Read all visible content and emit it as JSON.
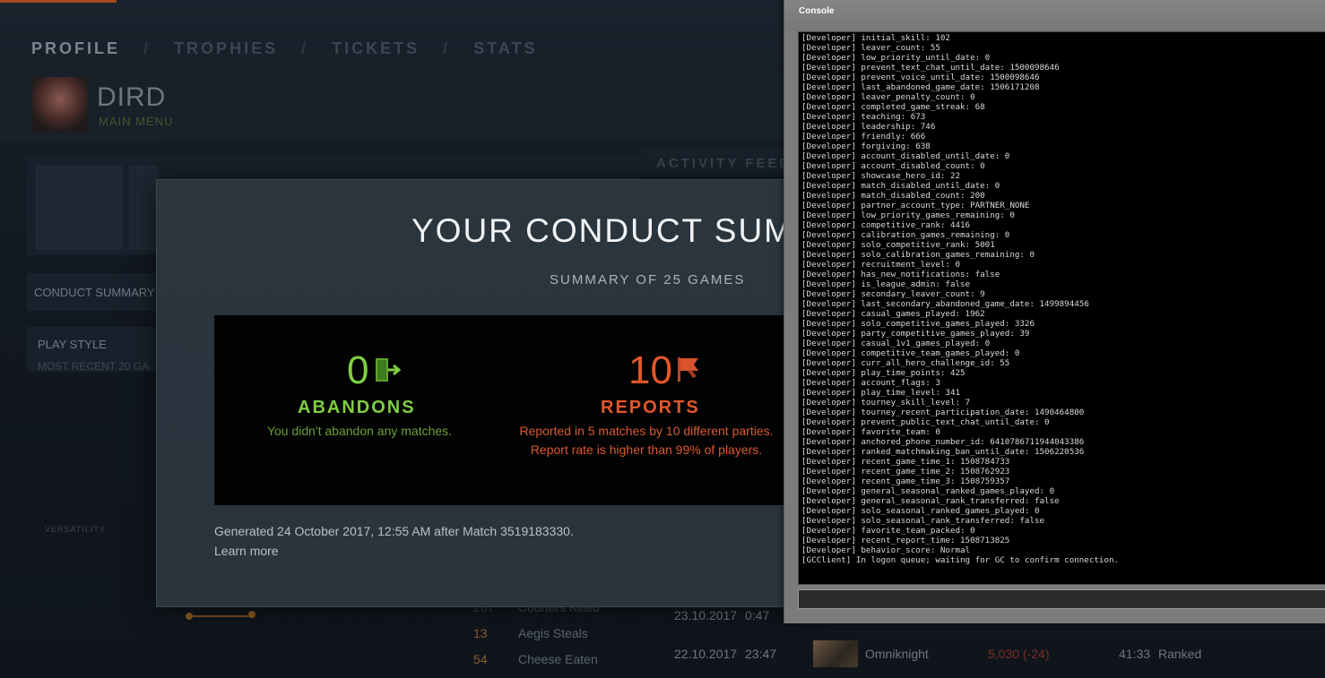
{
  "profile_nav": {
    "items": [
      "PROFILE",
      "TROPHIES",
      "TICKETS",
      "STATS"
    ],
    "separator": "/"
  },
  "player": {
    "name": "DIRD",
    "subtitle": "MAIN MENU"
  },
  "activity_feed": {
    "title": "ACTIVITY FEED"
  },
  "sidebar_labels": {
    "conduct_summary": "CONDUCT SUMMARY",
    "play_style": "PLAY STYLE",
    "most_recent": "MOST RECENT 20 GA",
    "versatility": "VERSATILITY"
  },
  "background_stats": [
    {
      "num": "13",
      "label": "Aegis Steals"
    },
    {
      "num": "54",
      "label": "Cheese Eaten"
    }
  ],
  "background_stats_partial": [
    {
      "num": "237",
      "label": "Couriers Killed"
    }
  ],
  "background_matches": [
    {
      "date": "23.10.2017",
      "time": "0:47"
    },
    {
      "date": "22.10.2017",
      "time": "23:47",
      "hero": "Omniknight",
      "mmr": "5,030 (-24)",
      "duration": "41:33",
      "mode": "Ranked"
    }
  ],
  "conduct": {
    "title": "YOUR CONDUCT SUMMARY",
    "subtitle": "SUMMARY OF 25 GAMES",
    "abandons": {
      "count": "0",
      "label": "ABANDONS",
      "desc": "You didn't abandon any matches."
    },
    "reports": {
      "count": "10",
      "label": "REPORTS",
      "desc_line1": "Reported in 5 matches by 10 different parties.",
      "desc_line2": "Report rate is higher than 99% of players."
    },
    "generated": "Generated 24 October 2017, 12:55 AM after Match 3519183330.",
    "learn_more": "Learn more",
    "colors": {
      "good": "#7fcf3f",
      "bad": "#e4572a"
    }
  },
  "console": {
    "title": "Console",
    "input_value": "",
    "lines": [
      "[Developer] initial_skill: 102",
      "[Developer] leaver_count: 55",
      "[Developer] low_priority_until_date: 0",
      "[Developer] prevent_text_chat_until_date: 1500098646",
      "[Developer] prevent_voice_until_date: 1500098646",
      "[Developer] last_abandoned_game_date: 1506171208",
      "[Developer] leaver_penalty_count: 0",
      "[Developer] completed_game_streak: 68",
      "[Developer] teaching: 673",
      "[Developer] leadership: 746",
      "[Developer] friendly: 666",
      "[Developer] forgiving: 638",
      "[Developer] account_disabled_until_date: 0",
      "[Developer] account_disabled_count: 0",
      "[Developer] showcase_hero_id: 22",
      "[Developer] match_disabled_until_date: 0",
      "[Developer] match_disabled_count: 200",
      "[Developer] partner_account_type: PARTNER_NONE",
      "[Developer] low_priority_games_remaining: 0",
      "[Developer] competitive_rank: 4416",
      "[Developer] calibration_games_remaining: 0",
      "[Developer] solo_competitive_rank: 5001",
      "[Developer] solo_calibration_games_remaining: 0",
      "[Developer] recruitment_level: 0",
      "[Developer] has_new_notifications: false",
      "[Developer] is_league_admin: false",
      "[Developer] secondary_leaver_count: 9",
      "[Developer] last_secondary_abandoned_game_date: 1499894456",
      "[Developer] casual_games_played: 1962",
      "[Developer] solo_competitive_games_played: 3326",
      "[Developer] party_competitive_games_played: 39",
      "[Developer] casual_1v1_games_played: 0",
      "[Developer] competitive_team_games_played: 0",
      "[Developer] curr_all_hero_challenge_id: 55",
      "[Developer] play_time_points: 425",
      "[Developer] account_flags: 3",
      "[Developer] play_time_level: 341",
      "[Developer] tourney_skill_level: 7",
      "[Developer] tourney_recent_participation_date: 1490464800",
      "[Developer] prevent_public_text_chat_until_date: 0",
      "[Developer] favorite_team: 0",
      "[Developer] anchored_phone_number_id: 6410786711944043386",
      "[Developer] ranked_matchmaking_ban_until_date: 1506220536",
      "[Developer] recent_game_time_1: 1508784733",
      "[Developer] recent_game_time_2: 1508762923",
      "[Developer] recent_game_time_3: 1508759357",
      "[Developer] general_seasonal_ranked_games_played: 0",
      "[Developer] general_seasonal_rank_transferred: false",
      "[Developer] solo_seasonal_ranked_games_played: 0",
      "[Developer] solo_seasonal_rank_transferred: false",
      "[Developer] favorite_team_packed: 0",
      "[Developer] recent_report_time: 1508713825",
      "[Developer] behavior_score: Normal",
      "[GCClient] In logon queue; waiting for GC to confirm connection."
    ]
  }
}
